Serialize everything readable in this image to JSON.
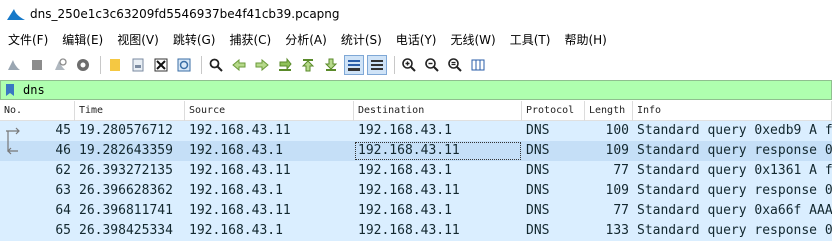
{
  "window": {
    "title": "dns_250e1c3c63209fd5546937be4f41cb39.pcapng"
  },
  "menu": [
    "文件(F)",
    "编辑(E)",
    "视图(V)",
    "跳转(G)",
    "捕获(C)",
    "分析(A)",
    "统计(S)",
    "电话(Y)",
    "无线(W)",
    "工具(T)",
    "帮助(H)"
  ],
  "toolbar": {
    "icons": [
      "start-capture-icon",
      "stop-capture-icon",
      "restart-capture-icon",
      "capture-options-icon",
      "open-file-icon",
      "save-file-icon",
      "close-file-icon",
      "reload-file-icon",
      "find-packet-icon",
      "go-back-icon",
      "go-forward-icon",
      "go-to-packet-icon",
      "first-packet-icon",
      "last-packet-icon",
      "autoscroll-icon",
      "colorize-icon",
      "zoom-in-icon",
      "zoom-out-icon",
      "normal-size-icon",
      "resize-columns-icon"
    ]
  },
  "filter": {
    "value": "dns"
  },
  "columns": {
    "no": "No.",
    "time": "Time",
    "source": "Source",
    "destination": "Destination",
    "protocol": "Protocol",
    "length": "Length",
    "info": "Info"
  },
  "packets": [
    {
      "no": "45",
      "time": "19.280576712",
      "source": "192.168.43.11",
      "destination": "192.168.43.1",
      "protocol": "DNS",
      "length": "100",
      "info": "Standard query 0xedb9 A f"
    },
    {
      "no": "46",
      "time": "19.282643359",
      "source": "192.168.43.1",
      "destination": "192.168.43.11",
      "protocol": "DNS",
      "length": "109",
      "info": "Standard query response 0"
    },
    {
      "no": "62",
      "time": "26.393272135",
      "source": "192.168.43.11",
      "destination": "192.168.43.1",
      "protocol": "DNS",
      "length": "77",
      "info": "Standard query 0x1361 A f"
    },
    {
      "no": "63",
      "time": "26.396628362",
      "source": "192.168.43.1",
      "destination": "192.168.43.11",
      "protocol": "DNS",
      "length": "109",
      "info": "Standard query response 0"
    },
    {
      "no": "64",
      "time": "26.396811741",
      "source": "192.168.43.11",
      "destination": "192.168.43.1",
      "protocol": "DNS",
      "length": "77",
      "info": "Standard query 0xa66f AAA"
    },
    {
      "no": "65",
      "time": "26.398425334",
      "source": "192.168.43.1",
      "destination": "192.168.43.11",
      "protocol": "DNS",
      "length": "133",
      "info": "Standard query response 0"
    }
  ],
  "colors": {
    "filter_bg": "#afffaf",
    "dns_row": "#daeeff",
    "selected_row": "#c5dff7"
  }
}
